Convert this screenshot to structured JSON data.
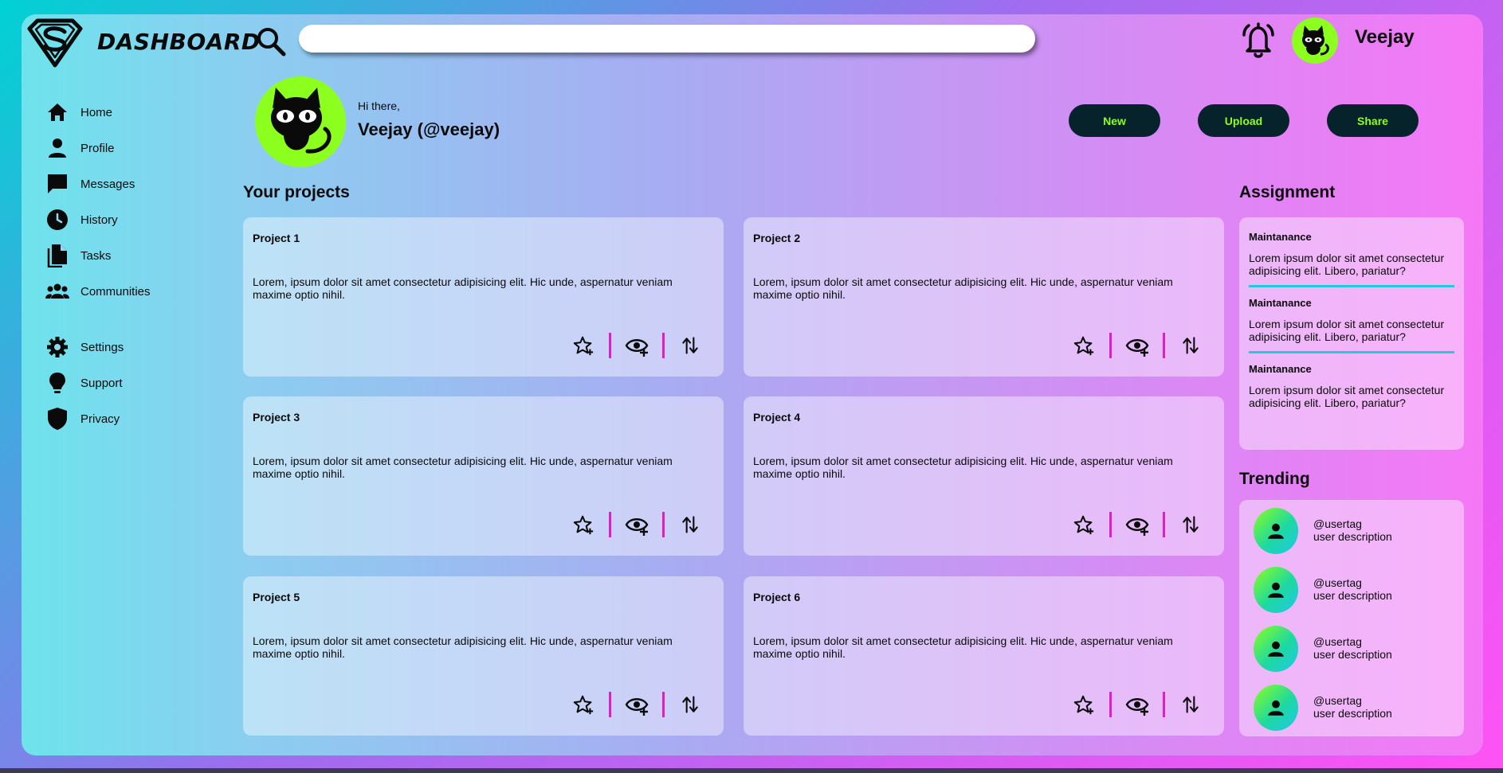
{
  "brand": {
    "name": "DASHBOARD",
    "logo_icon": "superman-shield-logo"
  },
  "search": {
    "placeholder": "",
    "value": ""
  },
  "header": {
    "username": "Veejay",
    "bell_icon": "bell-icon"
  },
  "sidebar": {
    "items": [
      {
        "label": "Home",
        "icon": "home-icon"
      },
      {
        "label": "Profile",
        "icon": "person-icon"
      },
      {
        "label": "Messages",
        "icon": "chat-icon"
      },
      {
        "label": "History",
        "icon": "clock-icon"
      },
      {
        "label": "Tasks",
        "icon": "document-icon"
      },
      {
        "label": "Communities",
        "icon": "group-icon"
      },
      {
        "label": "Settings",
        "icon": "gear-icon"
      },
      {
        "label": "Support",
        "icon": "lightbulb-icon"
      },
      {
        "label": "Privacy",
        "icon": "shield-icon"
      }
    ]
  },
  "greeting": {
    "hello": "Hi there,",
    "name": "Veejay (@veejay)"
  },
  "actions": {
    "new": "New",
    "upload": "Upload",
    "share": "Share"
  },
  "projects": {
    "title": "Your projects",
    "items": [
      {
        "title": "Project 1",
        "desc": "Lorem, ipsum dolor sit amet consectetur adipisicing elit. Hic unde, aspernatur veniam maxime optio nihil."
      },
      {
        "title": "Project 2",
        "desc": "Lorem, ipsum dolor sit amet consectetur adipisicing elit. Hic unde, aspernatur veniam maxime optio nihil."
      },
      {
        "title": "Project 3",
        "desc": "Lorem, ipsum dolor sit amet consectetur adipisicing elit. Hic unde, aspernatur veniam maxime optio nihil."
      },
      {
        "title": "Project 4",
        "desc": "Lorem, ipsum dolor sit amet consectetur adipisicing elit. Hic unde, aspernatur veniam maxime optio nihil."
      },
      {
        "title": "Project 5",
        "desc": "Lorem, ipsum dolor sit amet consectetur adipisicing elit. Hic unde, aspernatur veniam maxime optio nihil."
      },
      {
        "title": "Project 6",
        "desc": "Lorem, ipsum dolor sit amet consectetur adipisicing elit. Hic unde, aspernatur veniam maxime optio nihil."
      }
    ]
  },
  "assignment": {
    "title": "Assignment",
    "items": [
      {
        "title": "Maintanance",
        "desc": "Lorem ipsum dolor sit amet consectetur adipisicing elit. Libero, pariatur?"
      },
      {
        "title": "Maintanance",
        "desc": "Lorem ipsum dolor sit amet consectetur adipisicing elit. Libero, pariatur?"
      },
      {
        "title": "Maintanance",
        "desc": "Lorem ipsum dolor sit amet consectetur adipisicing elit. Libero, pariatur?"
      }
    ]
  },
  "trending": {
    "title": "Trending",
    "items": [
      {
        "tag": "@usertag",
        "desc": "user description"
      },
      {
        "tag": "@usertag",
        "desc": "user description"
      },
      {
        "tag": "@usertag",
        "desc": "user description"
      },
      {
        "tag": "@usertag",
        "desc": "user description"
      }
    ]
  },
  "colors": {
    "accent_green": "#8cff1e",
    "button_dark": "#06232b",
    "separator_magenta": "#e01dc8",
    "divider_cyan": "#1ecbe1"
  }
}
